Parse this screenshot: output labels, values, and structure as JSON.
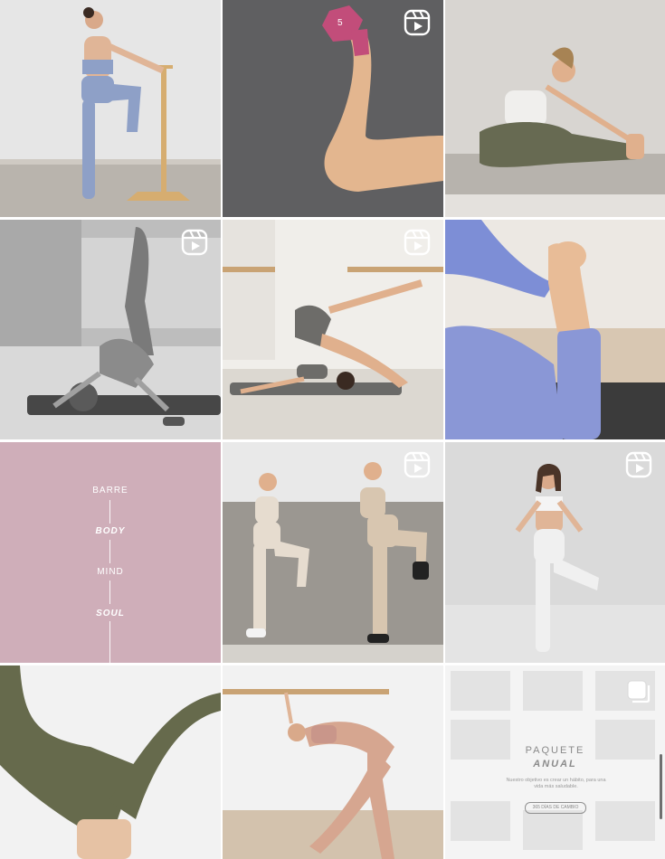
{
  "tiles": [
    {
      "kind": "photo",
      "subject": "woman at wooden barre raising knee",
      "reel": false
    },
    {
      "kind": "photo",
      "subject": "arm lifting pink dumbbell",
      "reel": true,
      "dumbbell_weight": "5"
    },
    {
      "kind": "photo",
      "subject": "seated forward fold stretch",
      "reel": false
    },
    {
      "kind": "photo",
      "subject": "black and white mat exercise",
      "reel": true
    },
    {
      "kind": "photo",
      "subject": "shoulder bridge leg extension",
      "reel": true
    },
    {
      "kind": "photo",
      "subject": "leg stretch in blue outfit",
      "reel": false
    },
    {
      "kind": "text",
      "reel": false
    },
    {
      "kind": "photo",
      "subject": "two women balancing on one leg",
      "reel": true
    },
    {
      "kind": "photo",
      "subject": "tree pose in white outfit",
      "reel": true
    },
    {
      "kind": "photo",
      "subject": "olive leggings inverted legs",
      "reel": false
    },
    {
      "kind": "photo",
      "subject": "side bend at barre",
      "reel": false
    },
    {
      "kind": "promo",
      "reel": false,
      "carousel": true
    }
  ],
  "text_tile": {
    "words": [
      "BARRE",
      "BODY",
      "MIND",
      "SOUL"
    ],
    "background": "#cfaeb9"
  },
  "promo_tile": {
    "title": "PAQUETE",
    "subtitle": "ANUAL",
    "body": "Nuestro objetivo es crear un hábito, para una vida más saludable.",
    "button": "365 DÍAS DE CAMBIO"
  },
  "colors": {
    "icon": "#ffffff",
    "lavender": "#8a94cf",
    "olive": "#6b6f55"
  }
}
